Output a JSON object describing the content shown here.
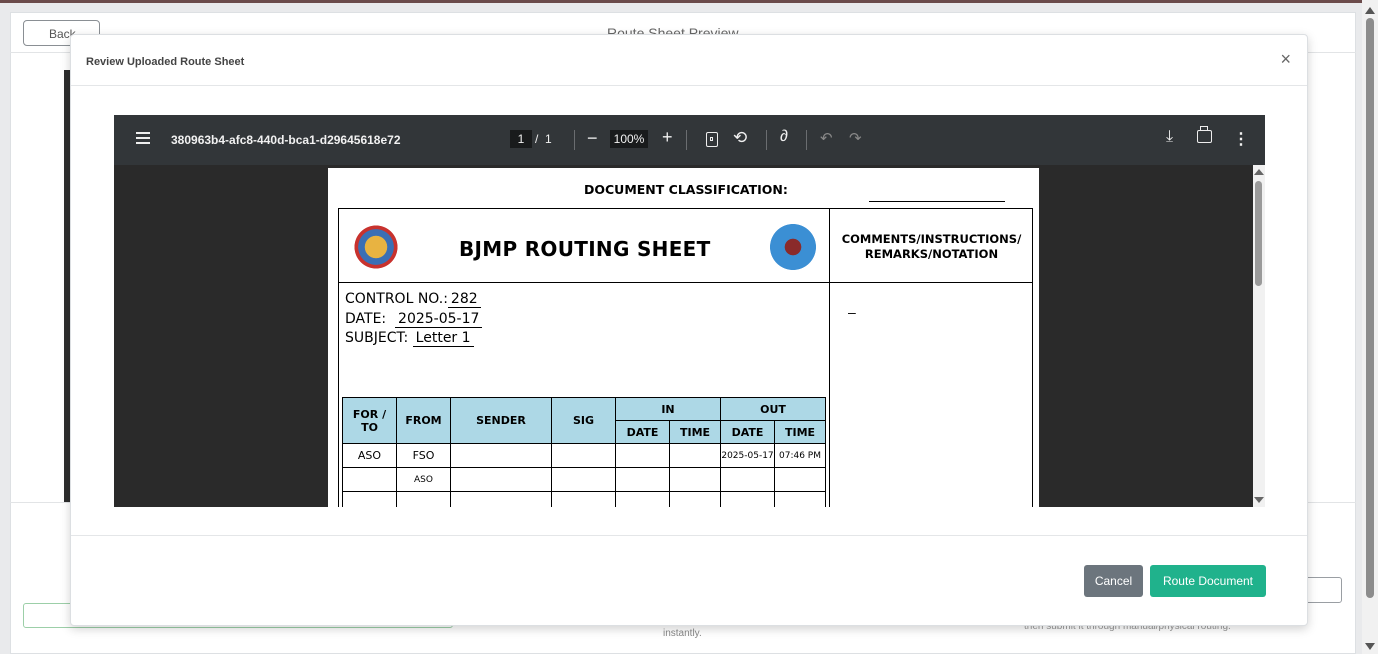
{
  "background": {
    "back_label": "Back",
    "page_title": "Route Sheet Preview",
    "note_left": "instantly.",
    "note_right": "then submit it through manual/physical routing."
  },
  "modal": {
    "title": "Review Uploaded Route Sheet",
    "close_glyph": "×",
    "cancel_label": "Cancel",
    "route_label": "Route Document"
  },
  "viewer": {
    "file_name": "380963b4-afc8-440d-bca1-d29645618e72",
    "current_page": "1",
    "page_separator": "/",
    "total_pages": "1",
    "zoom_minus": "−",
    "zoom": "100%",
    "zoom_plus": "+",
    "icons": [
      "menu-icon",
      "fit-page-icon",
      "rotate-icon",
      "draw-icon",
      "undo-icon",
      "redo-icon",
      "download-icon",
      "print-icon",
      "more-icon"
    ]
  },
  "document": {
    "classification_label": "DOCUMENT CLASSIFICATION:",
    "title": "BJMP ROUTING SHEET",
    "comments_header_line1": "COMMENTS/INSTRUCTIONS/",
    "comments_header_line2": "REMARKS/NOTATION",
    "comments_text": "–",
    "control_label": "CONTROL NO.:",
    "control_value": "282",
    "date_label": "DATE:",
    "date_value": "2025-05-17",
    "subject_label": "SUBJECT:",
    "subject_value": "Letter 1",
    "table": {
      "headers": {
        "for_to": "FOR / TO",
        "from": "FROM",
        "sender": "SENDER",
        "sig": "SIG",
        "in": "IN",
        "out": "OUT",
        "in_date": "DATE",
        "in_time": "TIME",
        "out_date": "DATE",
        "out_time": "TIME"
      },
      "rows": [
        {
          "for_to": "ASO",
          "from": "FSO",
          "sender": "",
          "sig": "",
          "in_date": "",
          "in_time": "",
          "out_date": "2025-05-17",
          "out_time": "07:46 PM"
        },
        {
          "for_to": "",
          "from": "ASO",
          "sender": "",
          "sig": "",
          "in_date": "",
          "in_time": "",
          "out_date": "",
          "out_time": ""
        }
      ]
    }
  },
  "colors": {
    "toolbar": "#323639",
    "table_header": "#add8e6",
    "route_button": "#20b28c",
    "cancel_button": "#6c757d"
  }
}
